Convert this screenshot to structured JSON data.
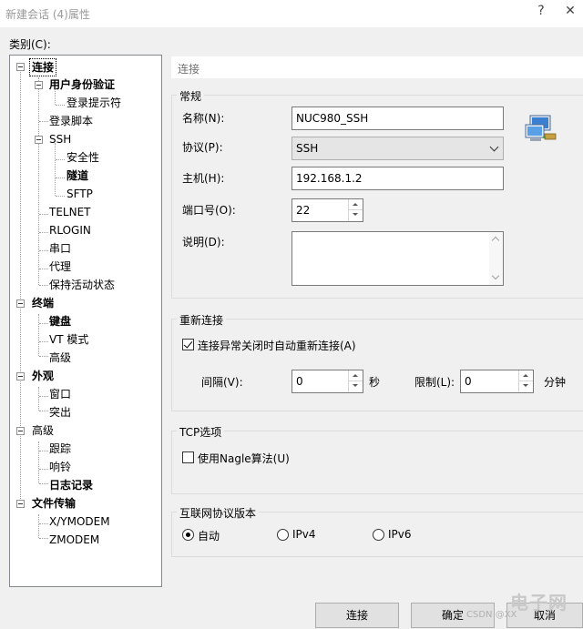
{
  "window": {
    "title": "新建会话 (4)属性",
    "help_label": "?",
    "close_label": "✕"
  },
  "category_label": "类别(C):",
  "tree": {
    "items": [
      {
        "label": "连接",
        "bold": true,
        "selected": true
      },
      {
        "label": "用户身份验证",
        "bold": true
      },
      {
        "label": "登录提示符",
        "bold": false
      },
      {
        "label": "登录脚本",
        "bold": false
      },
      {
        "label": "SSH",
        "bold": false
      },
      {
        "label": "安全性",
        "bold": false
      },
      {
        "label": "隧道",
        "bold": true
      },
      {
        "label": "SFTP",
        "bold": false
      },
      {
        "label": "TELNET",
        "bold": false
      },
      {
        "label": "RLOGIN",
        "bold": false
      },
      {
        "label": "串口",
        "bold": false
      },
      {
        "label": "代理",
        "bold": false
      },
      {
        "label": "保持活动状态",
        "bold": false
      },
      {
        "label": "终端",
        "bold": true
      },
      {
        "label": "键盘",
        "bold": true
      },
      {
        "label": "VT 模式",
        "bold": false
      },
      {
        "label": "高级",
        "bold": false
      },
      {
        "label": "外观",
        "bold": true
      },
      {
        "label": "窗口",
        "bold": false
      },
      {
        "label": "突出",
        "bold": false
      },
      {
        "label": "高级",
        "bold": false
      },
      {
        "label": "跟踪",
        "bold": false
      },
      {
        "label": "响铃",
        "bold": false
      },
      {
        "label": "日志记录",
        "bold": true
      },
      {
        "label": "文件传输",
        "bold": true
      },
      {
        "label": "X/YMODEM",
        "bold": false
      },
      {
        "label": "ZMODEM",
        "bold": false
      }
    ]
  },
  "content": {
    "header": "连接",
    "general": {
      "title": "常规",
      "name_label": "名称(N):",
      "name_value": "NUC980_SSH",
      "protocol_label": "协议(P):",
      "protocol_value": "SSH",
      "host_label": "主机(H):",
      "host_value": "192.168.1.2",
      "port_label": "端口号(O):",
      "port_value": "22",
      "desc_label": "说明(D):",
      "desc_value": ""
    },
    "reconnect": {
      "title": "重新连接",
      "auto_label": "连接异常关闭时自动重新连接(A)",
      "auto_checked": true,
      "interval_label": "间隔(V):",
      "interval_value": "0",
      "interval_unit": "秒",
      "limit_label": "限制(L):",
      "limit_value": "0",
      "limit_unit": "分钟"
    },
    "tcp": {
      "title": "TCP选项",
      "nagle_label": "使用Nagle算法(U)",
      "nagle_checked": false
    },
    "ipver": {
      "title": "互联网协议版本",
      "options": [
        "自动",
        "IPv4",
        "IPv6"
      ],
      "selected": "自动"
    }
  },
  "buttons": {
    "connect": "连接",
    "ok": "确定",
    "cancel": "取消"
  },
  "watermark": {
    "line1": "电子网",
    "line2": "CSDN @XX"
  }
}
